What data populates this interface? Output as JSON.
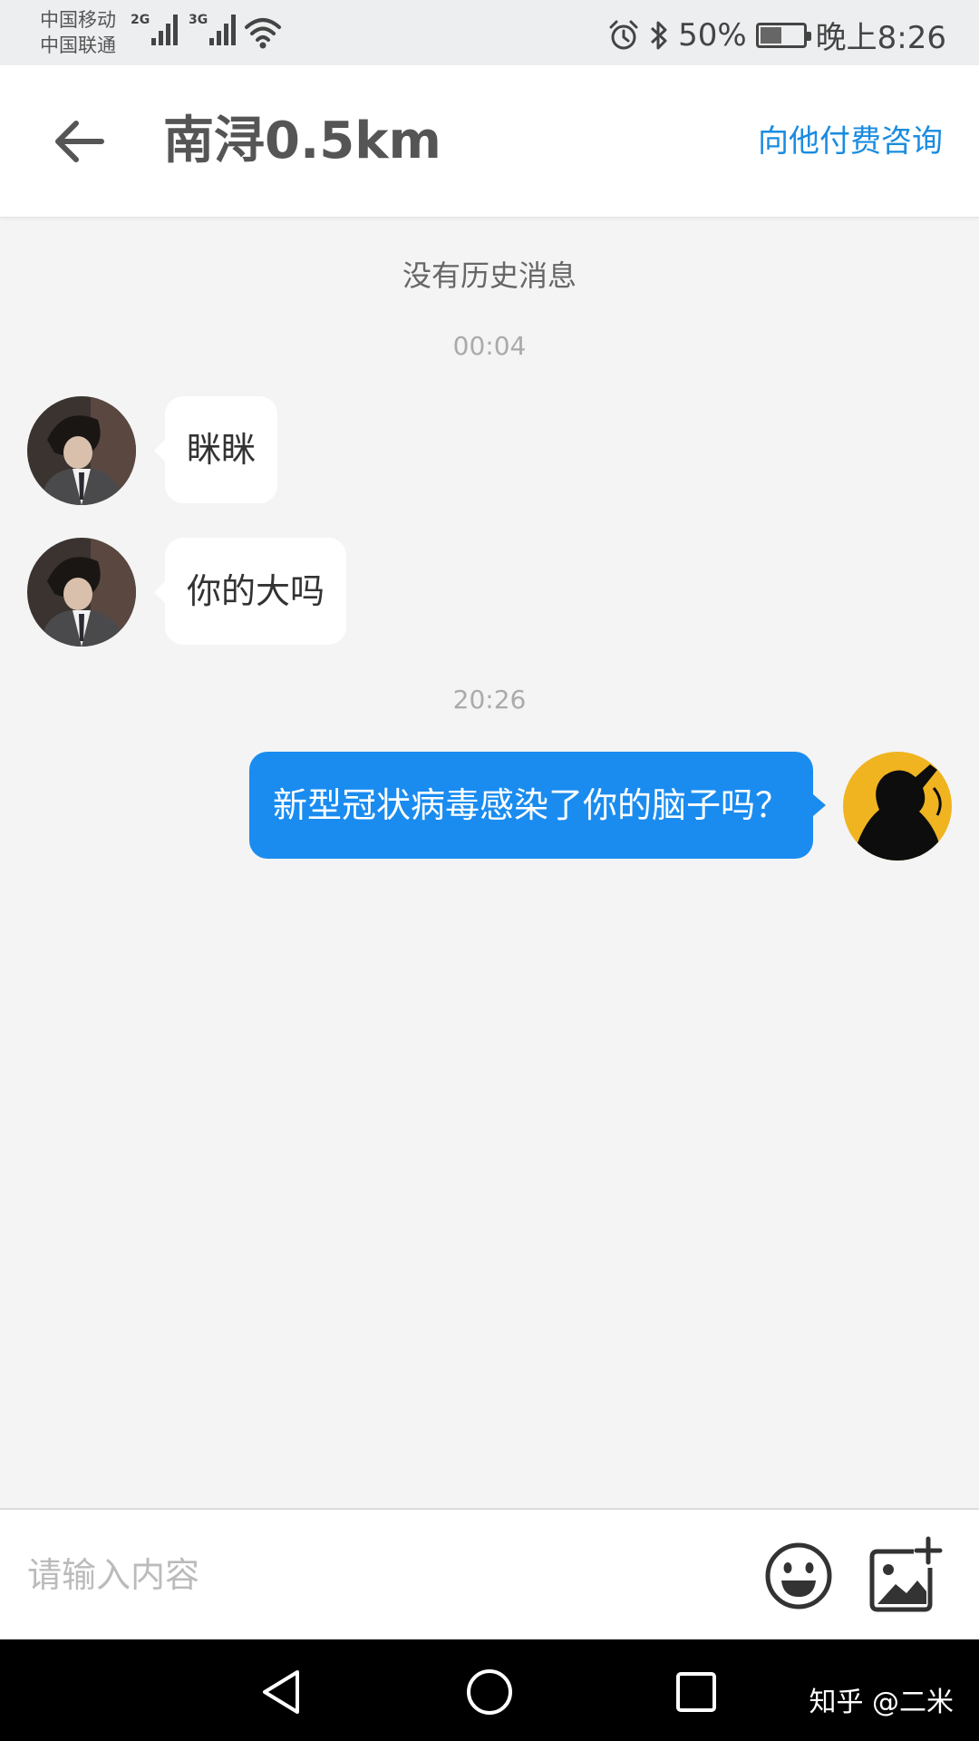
{
  "status_bar": {
    "carrier_1": "中国移动",
    "carrier_2": "中国联通",
    "net_1": "2G",
    "net_2": "3G",
    "battery": "50%",
    "time": "晚上8:26",
    "icons": [
      "signal-icon",
      "wifi-icon",
      "alarm-icon",
      "bluetooth-icon",
      "battery-icon"
    ]
  },
  "header": {
    "title": "南浔0.5km",
    "consult_label": "向他付费咨询",
    "back_icon": "arrow-left-icon",
    "accent_color": "#1a8ce0"
  },
  "chat": {
    "no_history": "没有历史消息",
    "messages": [
      {
        "time": "00:04"
      },
      {
        "side": "left",
        "text": "眯眯"
      },
      {
        "side": "left",
        "text": "你的大吗"
      },
      {
        "time": "20:26"
      },
      {
        "side": "right",
        "text": "新型冠状病毒感染了你的脑子吗？"
      }
    ],
    "outgoing_bubble_color": "#1a8cf0"
  },
  "input_bar": {
    "placeholder": "请输入内容",
    "icons": [
      "emoji-icon",
      "image-add-icon"
    ]
  },
  "nav_bar": {
    "icons": [
      "back-triangle-icon",
      "home-circle-icon",
      "recents-square-icon"
    ],
    "watermark": "知乎 @二米"
  }
}
